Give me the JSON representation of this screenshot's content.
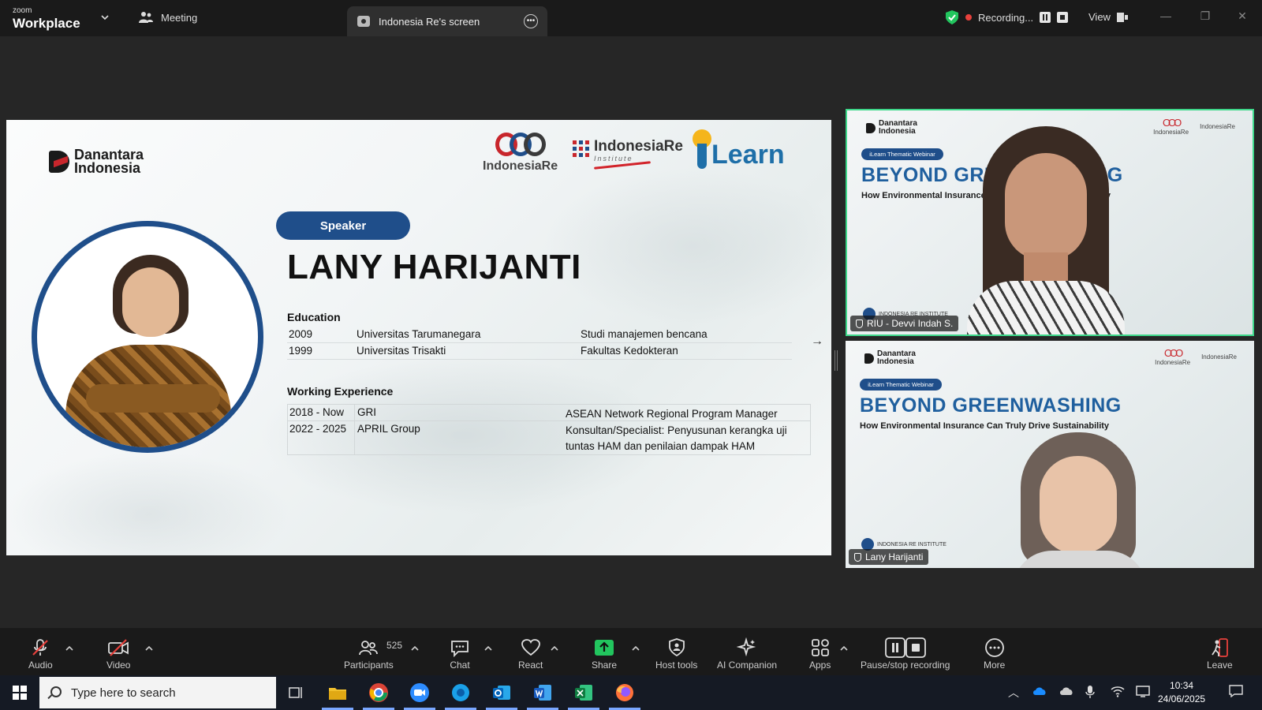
{
  "titlebar": {
    "brand_small": "zoom",
    "brand_big": "Workplace",
    "meeting_label": "Meeting",
    "tab_label": "Indonesia Re's screen",
    "recording_label": "Recording...",
    "view_label": "View"
  },
  "slide": {
    "logo_danantara": "Danantara Indonesia",
    "logo_indonesiare": "IndonesiaRe",
    "logo_institute_top": "IndonesiaRe",
    "logo_institute_sub": "Institute",
    "logo_learn": "Learn",
    "pill": "Speaker",
    "name": "LANY HARIJANTI",
    "education_heading": "Education",
    "education": [
      {
        "year": "2009",
        "school": "Universitas Tarumanegara",
        "field": "Studi manajemen bencana"
      },
      {
        "year": "1999",
        "school": "Universitas Trisakti",
        "field": "Fakultas Kedokteran"
      }
    ],
    "work_heading": "Working Experience",
    "work": [
      {
        "years": "2018 - Now",
        "org": "GRI",
        "role": "ASEAN Network Regional Program Manager"
      },
      {
        "years": "2022 - 2025",
        "org": "APRIL Group",
        "role": "Konsultan/Specialist: Penyusunan kerangka uji tuntas HAM dan penilaian dampak HAM"
      }
    ]
  },
  "tiles": [
    {
      "logo": "Danantara Indonesia",
      "logo_right1": "IndonesiaRe",
      "logo_right2": "IndonesiaRe",
      "pill": "iLearn Thematic Webinar",
      "heading": "BEYOND GREENWASHING",
      "sub": "How Environmental Insurance Can Truly Drive Sustainability",
      "foot": "INDONESIA RE INSTITUTE",
      "name": "RIU - Devvi Indah S."
    },
    {
      "logo": "Danantara Indonesia",
      "logo_right1": "IndonesiaRe",
      "logo_right2": "IndonesiaRe",
      "pill": "iLearn Thematic Webinar",
      "heading": "BEYOND GREENWASHING",
      "sub": "How Environmental Insurance Can Truly Drive Sustainability",
      "foot": "INDONESIA RE INSTITUTE",
      "name": "Lany Harijanti"
    }
  ],
  "toolbar": {
    "audio": "Audio",
    "video": "Video",
    "participants": "Participants",
    "participants_count": "525",
    "chat": "Chat",
    "react": "React",
    "share": "Share",
    "host_tools": "Host tools",
    "ai_companion": "AI Companion",
    "apps": "Apps",
    "pause_stop": "Pause/stop recording",
    "more": "More",
    "leave": "Leave"
  },
  "taskbar": {
    "search_placeholder": "Type here to search",
    "time": "10:34",
    "date": "24/06/2025"
  },
  "colors": {
    "accent_green": "#3ed88a",
    "slide_blue": "#1f4e8a",
    "recording_red": "#e8413c",
    "share_green": "#22c55e"
  }
}
